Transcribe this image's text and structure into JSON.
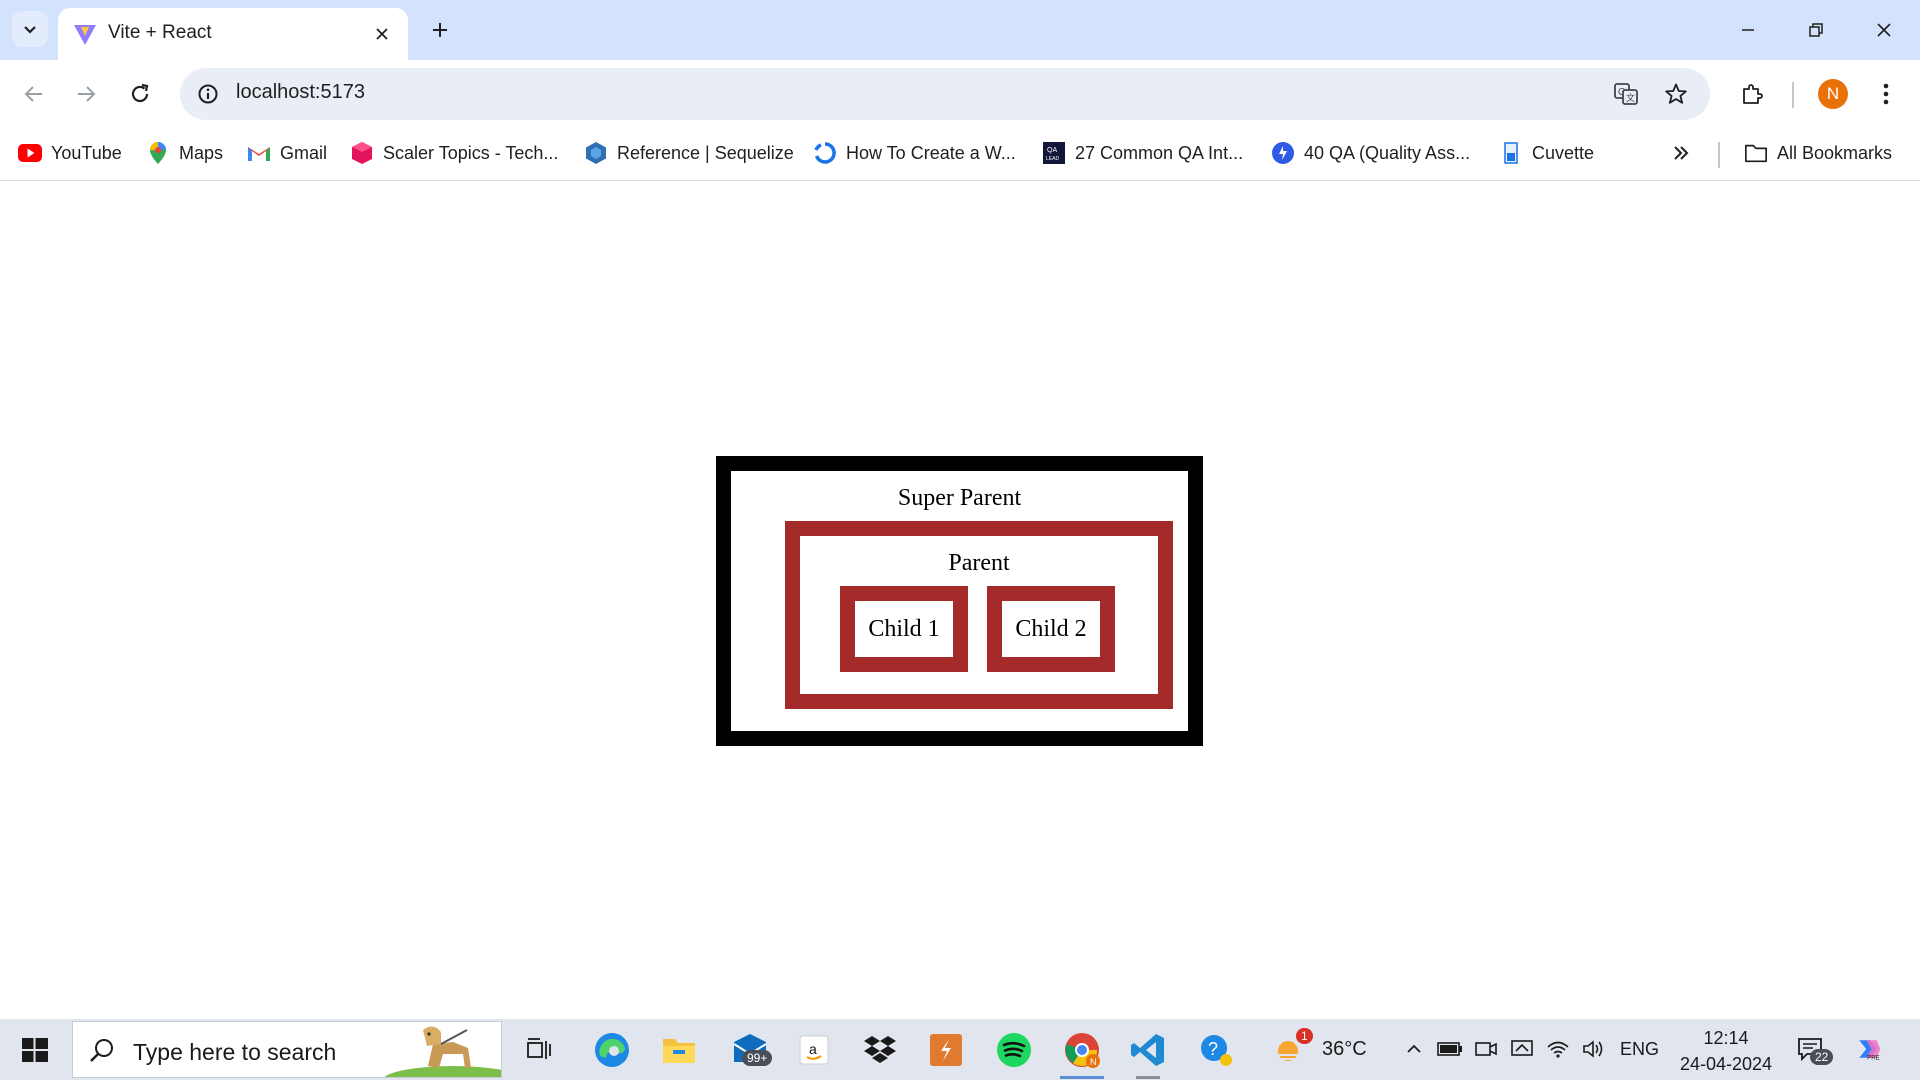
{
  "browser": {
    "tab": {
      "title": "Vite + React"
    },
    "address": {
      "url": "localhost:5173"
    },
    "profile_initial": "N"
  },
  "bookmarks": [
    {
      "label": "YouTube",
      "icon": "youtube-icon"
    },
    {
      "label": "Maps",
      "icon": "maps-icon"
    },
    {
      "label": "Gmail",
      "icon": "gmail-icon"
    },
    {
      "label": "Scaler Topics - Tech...",
      "icon": "scaler-icon"
    },
    {
      "label": "Reference | Sequelize",
      "icon": "sequelize-icon"
    },
    {
      "label": "How To Create a W...",
      "icon": "loop-icon"
    },
    {
      "label": "27 Common QA Int...",
      "icon": "qa-lead-icon"
    },
    {
      "label": "40 QA (Quality Ass...",
      "icon": "qa-icon"
    },
    {
      "label": "Cuvette",
      "icon": "cuvette-icon"
    }
  ],
  "bookmarks_all": "All Bookmarks",
  "page": {
    "super_parent": "Super Parent",
    "parent": "Parent",
    "child1": "Child 1",
    "child2": "Child 2"
  },
  "colors": {
    "super_parent_border": "#000000",
    "parent_border": "#a52a2a",
    "child_border": "#a52a2a"
  },
  "taskbar": {
    "search_placeholder": "Type here to search",
    "mail_badge": "99+",
    "weather_badge": "1",
    "temperature": "36°C",
    "language": "ENG",
    "time": "12:14",
    "date": "24-04-2024",
    "notification_count": "22"
  }
}
